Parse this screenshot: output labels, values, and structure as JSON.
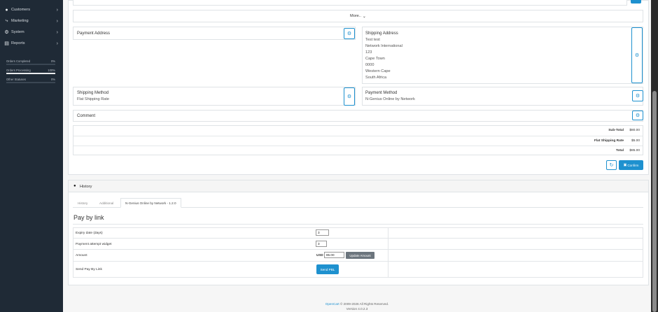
{
  "sidebar": {
    "items": [
      {
        "label": "Customers",
        "icon": "user-icon"
      },
      {
        "label": "Marketing",
        "icon": "share-icon"
      },
      {
        "label": "System",
        "icon": "gear-icon"
      },
      {
        "label": "Reports",
        "icon": "chart-icon"
      }
    ],
    "stats": [
      {
        "label": "Orders Completed",
        "value": "0%",
        "fill": 0.0
      },
      {
        "label": "Orders Processing",
        "value": "100%",
        "fill": 1.0
      },
      {
        "label": "Other Statuses",
        "value": "0%",
        "fill": 0.0
      }
    ]
  },
  "order": {
    "more_label": "More..",
    "payment_address_title": "Payment Address",
    "shipping_address_title": "Shipping Address",
    "shipping_address_lines": [
      "Test test",
      "Network International",
      "123",
      "Cape Town",
      "0000",
      "Western Cape",
      "South Africa"
    ],
    "shipping_method_title": "Shipping Method",
    "shipping_method_value": "Flat Shipping Rate",
    "payment_method_title": "Payment Method",
    "payment_method_value": "N-Genius Online by Network",
    "comment_title": "Comment",
    "totals": [
      {
        "label": "Sub-Total",
        "value": "$80.00"
      },
      {
        "label": "Flat Shipping Rate",
        "value": "$5.00"
      },
      {
        "label": "Total",
        "value": "$85.00"
      }
    ],
    "confirm_label": "Confirm"
  },
  "history": {
    "title": "History",
    "tabs": [
      "History",
      "Additional",
      "N-Genius Online by Network - 1.2.0"
    ],
    "active_tab": 2
  },
  "paybylink": {
    "heading": "Pay by link",
    "fields": {
      "expiry_label": "Expiry date (days)",
      "expiry_value": "3",
      "attempt_label": "Payment attempt widget",
      "attempt_value": "3",
      "amount_label": "Amount",
      "currency": "USD",
      "amount_value": "85.00",
      "update_amount_label": "Update Amount",
      "send_label": "Send Pay By Link",
      "send_button_label": "Send PBL"
    }
  },
  "footer": {
    "link_text": "OpenCart",
    "copyright": " © 2009-2026 All Rights Reserved.",
    "version": "Version 4.0.2.3"
  },
  "colors": {
    "sidebar_bg": "#1f2a36",
    "accent": "#1e91cf",
    "gray_button": "#6c757d"
  }
}
